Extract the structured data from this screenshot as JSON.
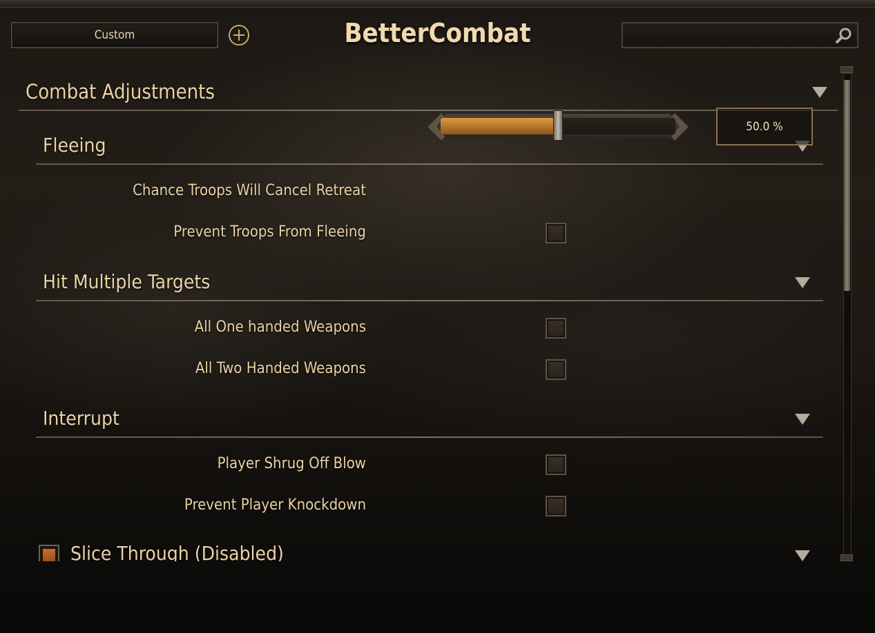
{
  "header": {
    "preset_value": "Custom",
    "title": "BetterCombat",
    "search_placeholder": ""
  },
  "sections": {
    "combat_adjustments": {
      "title": "Combat Adjustments"
    },
    "fleeing": {
      "title": "Fleeing",
      "chance_cancel_retreat": {
        "label": "Chance Troops Will Cancel Retreat",
        "value_text": "50.0 %",
        "value_fraction": 0.5
      },
      "prevent_fleeing": {
        "label": "Prevent Troops From Fleeing",
        "checked": false
      }
    },
    "hit_multiple_targets": {
      "title": "Hit Multiple Targets",
      "one_handed": {
        "label": "All One handed Weapons",
        "checked": false
      },
      "two_handed": {
        "label": "All Two Handed Weapons",
        "checked": false
      }
    },
    "interrupt": {
      "title": "Interrupt",
      "shrug_off": {
        "label": "Player Shrug Off Blow",
        "checked": false
      },
      "prevent_knockdown": {
        "label": "Prevent Player Knockdown",
        "checked": false
      }
    },
    "slice_through": {
      "title": "Slice Through (Disabled)",
      "enabled_toggle": true
    }
  },
  "icons": {
    "add": "plus-circle-icon",
    "search": "magnifier-icon",
    "collapse": "triangle-down-icon"
  },
  "colors": {
    "text": "#ead2a6",
    "accent": "#c9a86a",
    "slider_fill": "#d89a40",
    "toggle_orange": "#c6702f"
  }
}
